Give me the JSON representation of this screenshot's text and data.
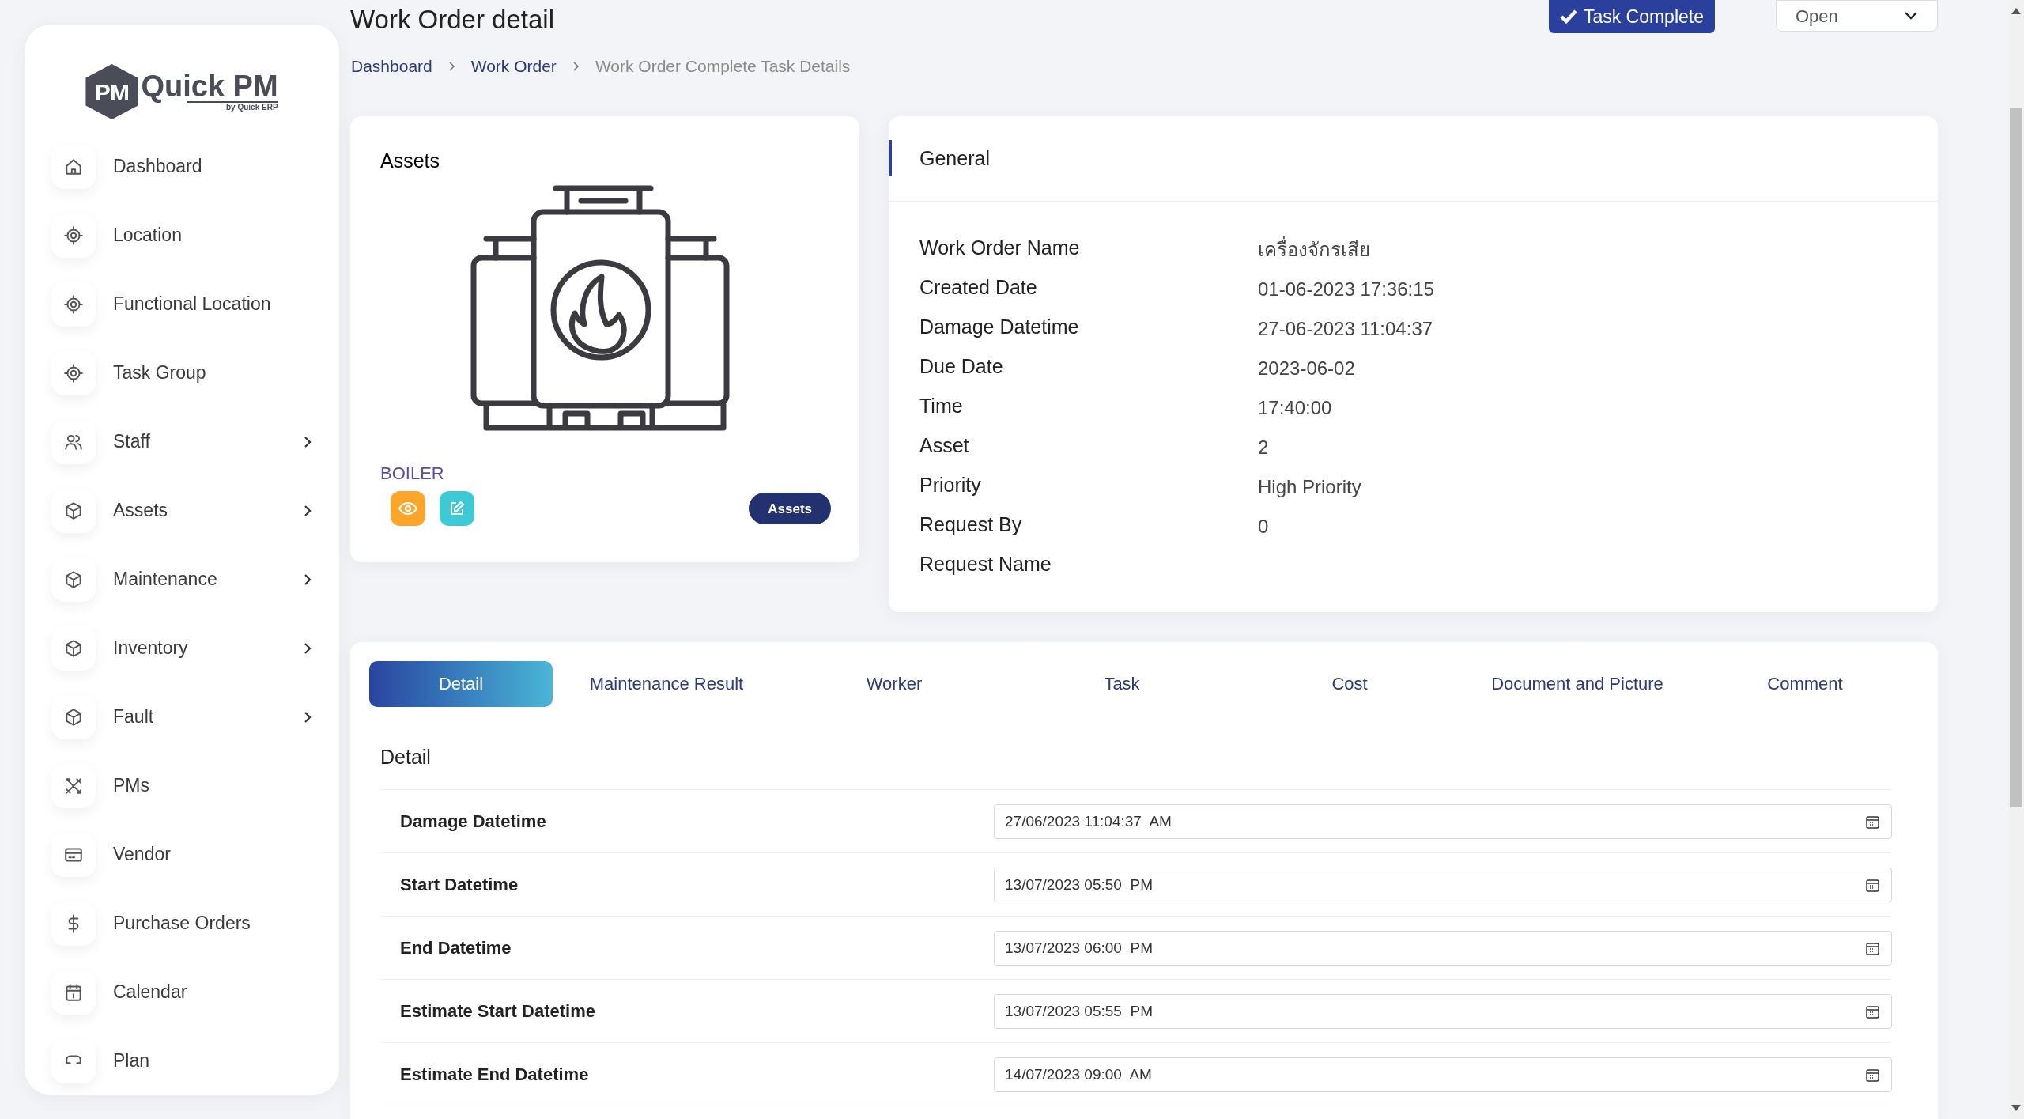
{
  "logo": {
    "badge": "PM",
    "name": "Quick PM",
    "tagline": "by Quick ERP"
  },
  "sidebar": {
    "items": [
      {
        "label": "Dashboard",
        "has_submenu": false
      },
      {
        "label": "Location",
        "has_submenu": false
      },
      {
        "label": "Functional Location",
        "has_submenu": false
      },
      {
        "label": "Task Group",
        "has_submenu": false
      },
      {
        "label": "Staff",
        "has_submenu": true
      },
      {
        "label": "Assets",
        "has_submenu": true
      },
      {
        "label": "Maintenance",
        "has_submenu": true
      },
      {
        "label": "Inventory",
        "has_submenu": true
      },
      {
        "label": "Fault",
        "has_submenu": true
      },
      {
        "label": "PMs",
        "has_submenu": false
      },
      {
        "label": "Vendor",
        "has_submenu": false
      },
      {
        "label": "Purchase Orders",
        "has_submenu": false
      },
      {
        "label": "Calendar",
        "has_submenu": false
      },
      {
        "label": "Plan",
        "has_submenu": false
      }
    ]
  },
  "header": {
    "title": "Work Order detail",
    "action_button": "Task Complete",
    "status": "Open"
  },
  "breadcrumb": [
    {
      "label": "Dashboard",
      "link": true
    },
    {
      "label": "Work Order",
      "link": true
    },
    {
      "label": "Work Order Complete Task Details",
      "link": false
    }
  ],
  "assets_card": {
    "title": "Assets",
    "asset_name": "BOILER",
    "button": "Assets"
  },
  "general": {
    "title": "General",
    "fields": [
      {
        "label": "Work Order Name",
        "value": "เครื่องจักรเสีย"
      },
      {
        "label": "Created Date",
        "value": "01-06-2023 17:36:15"
      },
      {
        "label": "Damage Datetime",
        "value": "27-06-2023 11:04:37"
      },
      {
        "label": "Due Date",
        "value": "2023-06-02"
      },
      {
        "label": "Time",
        "value": "17:40:00"
      },
      {
        "label": "Asset",
        "value": "2"
      },
      {
        "label": "Priority",
        "value": "High Priority"
      },
      {
        "label": "Request By",
        "value": "0"
      },
      {
        "label": "Request Name"
      }
    ]
  },
  "tabs": [
    {
      "label": "Detail",
      "selected": true
    },
    {
      "label": "Maintenance Result",
      "selected": false
    },
    {
      "label": "Worker",
      "selected": false
    },
    {
      "label": "Task",
      "selected": false
    },
    {
      "label": "Cost",
      "selected": false
    },
    {
      "label": "Document and Picture",
      "selected": false
    },
    {
      "label": "Comment",
      "selected": false
    }
  ],
  "detail": {
    "title": "Detail",
    "fields": [
      {
        "label": "Damage Datetime",
        "value": "27/06/2023 11:04:37  AM"
      },
      {
        "label": "Start Datetime",
        "value": "13/07/2023 05:50  PM"
      },
      {
        "label": "End Datetime",
        "value": "13/07/2023 06:00  PM"
      },
      {
        "label": "Estimate Start Datetime",
        "value": "13/07/2023 05:55  PM"
      },
      {
        "label": "Estimate End Datetime",
        "value": "14/07/2023 09:00  AM"
      }
    ]
  }
}
